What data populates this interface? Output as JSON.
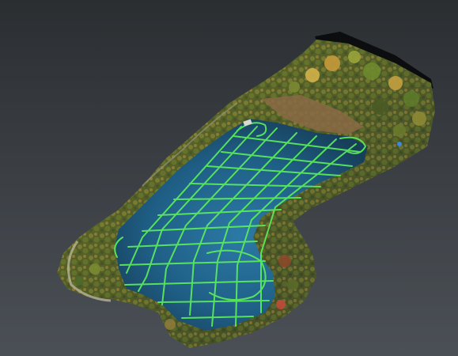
{
  "viewport": {
    "background_top": "#2b2e31",
    "background_bottom": "#4b5056"
  },
  "model": {
    "water_color": "#1f5f86",
    "track_color": "#5df05a",
    "vegetation_color": "#6b6a2e",
    "icon": "3d-terrain-mesh-icon"
  }
}
